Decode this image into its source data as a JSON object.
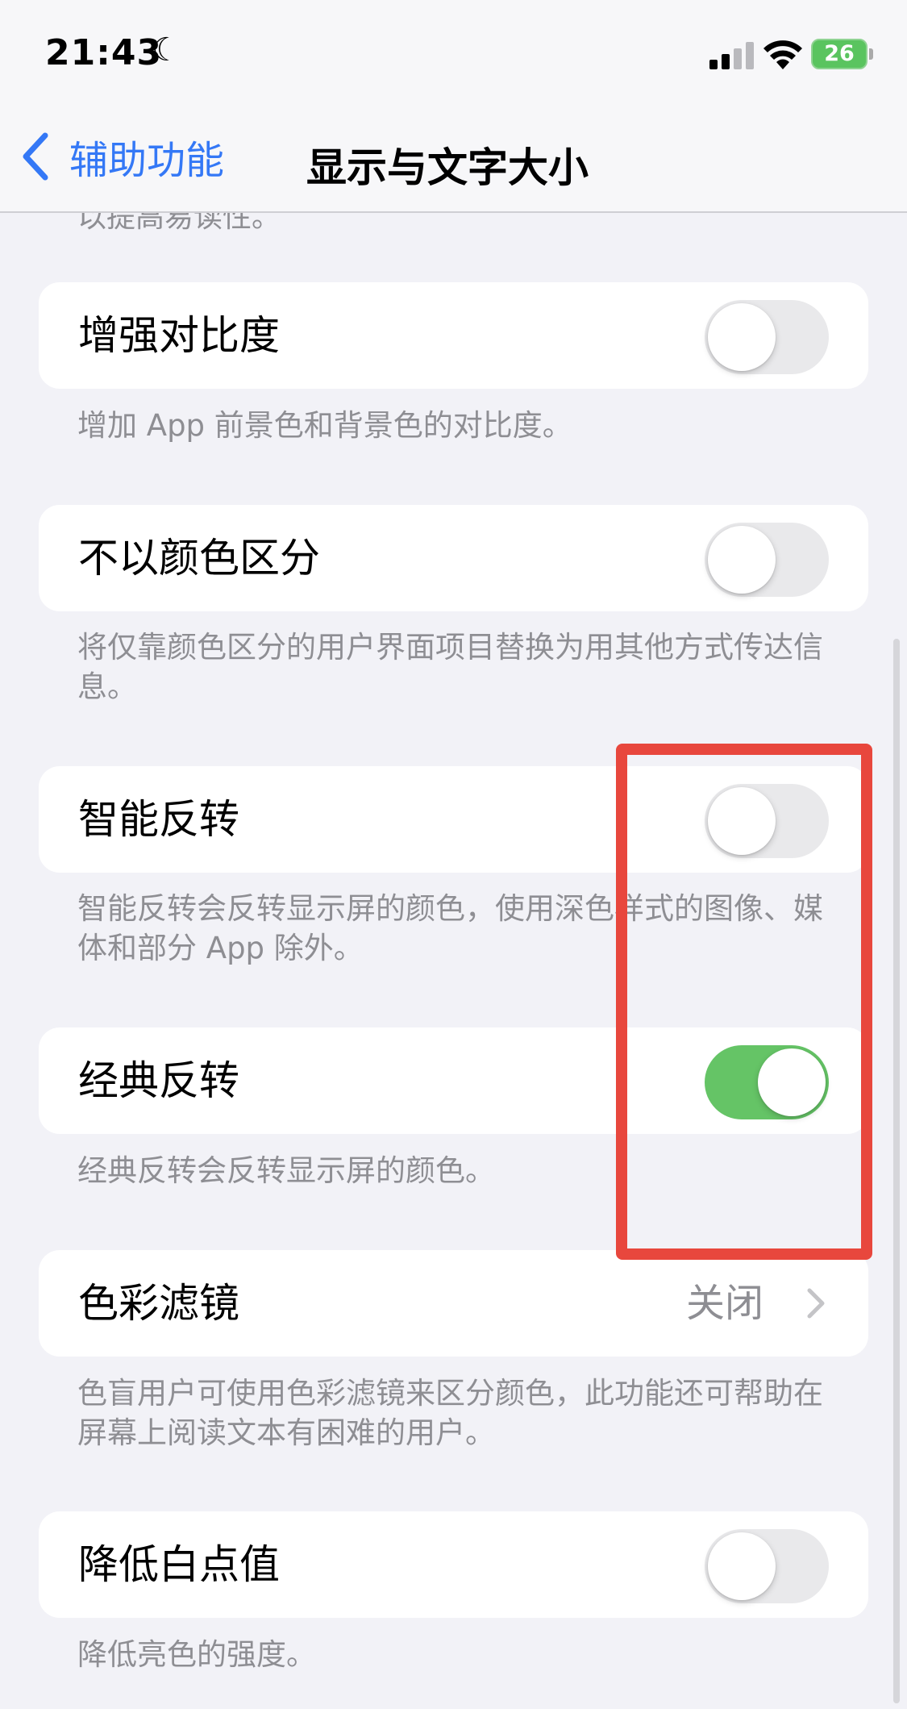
{
  "status_bar": {
    "time": "21:43",
    "battery_level": "26",
    "icons": [
      "moon-icon",
      "cellular-signal-icon",
      "wifi-icon",
      "battery-charging-icon"
    ]
  },
  "nav": {
    "back_label": "辅助功能",
    "title": "显示与文字大小"
  },
  "clipped_text": "以提高易读性。",
  "settings": {
    "increase_contrast": {
      "label": "增强对比度",
      "on": false,
      "footer": "增加 App 前景色和背景色的对比度。"
    },
    "differentiate_without_color": {
      "label": "不以颜色区分",
      "on": false,
      "footer": "将仅靠颜色区分的用户界面项目替换为用其他方式传达信息。"
    },
    "smart_invert": {
      "label": "智能反转",
      "on": false,
      "footer": "智能反转会反转显示屏的颜色，使用深色样式的图像、媒体和部分 App 除外。"
    },
    "classic_invert": {
      "label": "经典反转",
      "on": true,
      "footer": "经典反转会反转显示屏的颜色。"
    },
    "color_filters": {
      "label": "色彩滤镜",
      "value": "关闭",
      "footer": "色盲用户可使用色彩滤镜来区分颜色，此功能还可帮助在屏幕上阅读文本有困难的用户。"
    },
    "reduce_white_point": {
      "label": "降低白点值",
      "on": false,
      "footer": "降低亮色的强度。"
    }
  },
  "colors": {
    "accent": "#3478f6",
    "toggle_on": "#65c466",
    "toggle_off": "#e9e9eb",
    "highlight": "#e8473d",
    "background": "#f2f2f7"
  }
}
